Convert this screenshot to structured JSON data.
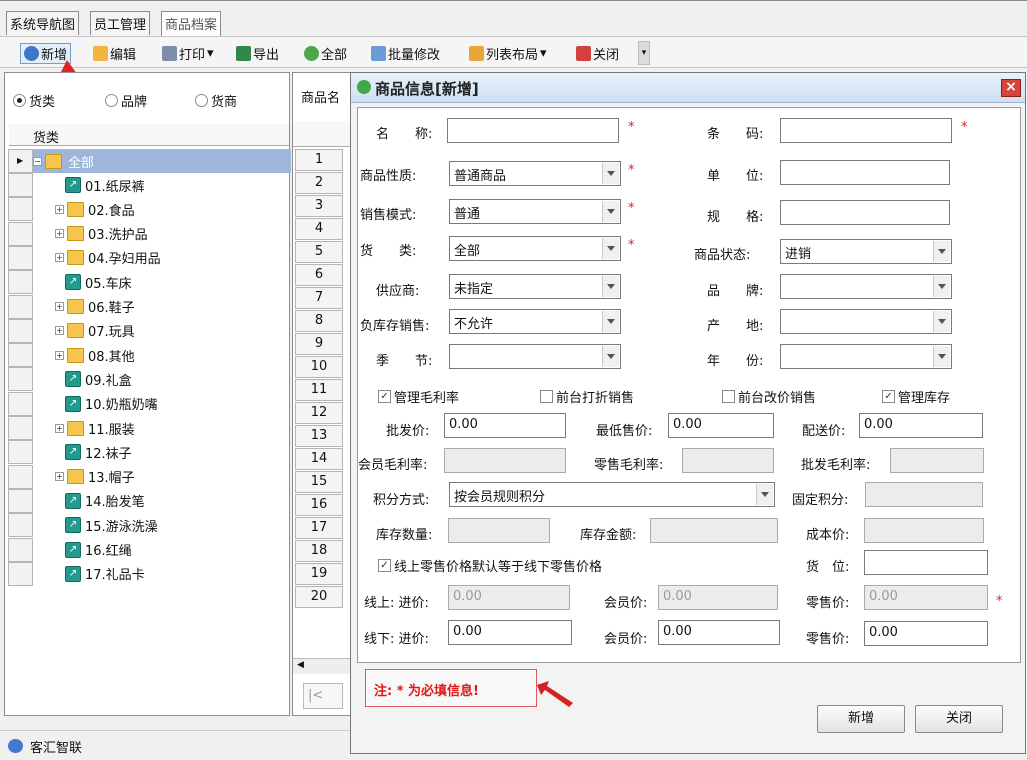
{
  "tabs": [
    "系统导航图",
    "员工管理",
    "商品档案"
  ],
  "toolbar": {
    "add": "新增",
    "edit": "编辑",
    "print": "打印",
    "export": "导出",
    "all": "全部",
    "batch": "批量修改",
    "layout": "列表布局",
    "close": "关闭"
  },
  "left": {
    "radios": [
      "货类",
      "品牌",
      "货商"
    ],
    "tree_header": "货类",
    "root": "全部",
    "items": [
      "01.纸尿裤",
      "02.食品",
      "03.洗护品",
      "04.孕妇用品",
      "05.车床",
      "06.鞋子",
      "07.玩具",
      "08.其他",
      "09.礼盒",
      "10.奶瓶奶嘴",
      "11.服装",
      "12.袜子",
      "13.帽子",
      "14.胎发笔",
      "15.游泳洗澡",
      "16.红绳",
      "17.礼品卡"
    ]
  },
  "mid": {
    "header": "商品名",
    "rows": [
      "1",
      "2",
      "3",
      "4",
      "5",
      "6",
      "7",
      "8",
      "9",
      "10",
      "11",
      "12",
      "13",
      "14",
      "15",
      "16",
      "17",
      "18",
      "19",
      "20"
    ]
  },
  "status": {
    "brand": "客汇智联"
  },
  "dialog": {
    "title": "商品信息[新增]",
    "close": "×",
    "labels": {
      "name": "名　　称:",
      "barcode": "条　　码:",
      "nature": "商品性质:",
      "unit": "单　　位:",
      "sale_mode": "销售模式:",
      "spec": "规　　格:",
      "category": "货　　类:",
      "status": "商品状态:",
      "supplier": "供应商:",
      "brand": "品　　牌:",
      "neg_stock": "负库存销售:",
      "origin": "产　　地:",
      "season": "季　　节:",
      "year": "年　　份:",
      "wholesale": "批发价:",
      "min_price": "最低售价:",
      "delivery": "配送价:",
      "member_margin": "会员毛利率:",
      "retail_margin": "零售毛利率:",
      "wholesale_margin": "批发毛利率:",
      "points_method": "积分方式:",
      "fixed_points": "固定积分:",
      "stock_qty": "库存数量:",
      "stock_amount": "库存金额:",
      "cost": "成本价:",
      "location": "货　位:",
      "online_cost": "线上: 进价:",
      "online_member": "会员价:",
      "online_retail": "零售价:",
      "offline_cost": "线下: 进价:",
      "offline_member": "会员价:",
      "offline_retail": "零售价:"
    },
    "values": {
      "nature": "普通商品",
      "sale_mode": "普通",
      "category": "全部",
      "status": "进销",
      "supplier": "未指定",
      "neg_stock": "不允许",
      "wholesale": "0.00",
      "min_price": "0.00",
      "delivery": "0.00",
      "points_method": "按会员规则积分",
      "online_cost": "0.00",
      "online_member": "0.00",
      "online_retail": "0.00",
      "offline_cost": "0.00",
      "offline_member": "0.00",
      "offline_retail": "0.00"
    },
    "checks": {
      "margin": "管理毛利率",
      "discount": "前台打折销售",
      "price_change": "前台改价销售",
      "inventory": "管理库存",
      "online_sync": "线上零售价格默认等于线下零售价格"
    },
    "req": "*",
    "note": "注: * 为必填信息!",
    "btn_add": "新增",
    "btn_close": "关闭"
  }
}
